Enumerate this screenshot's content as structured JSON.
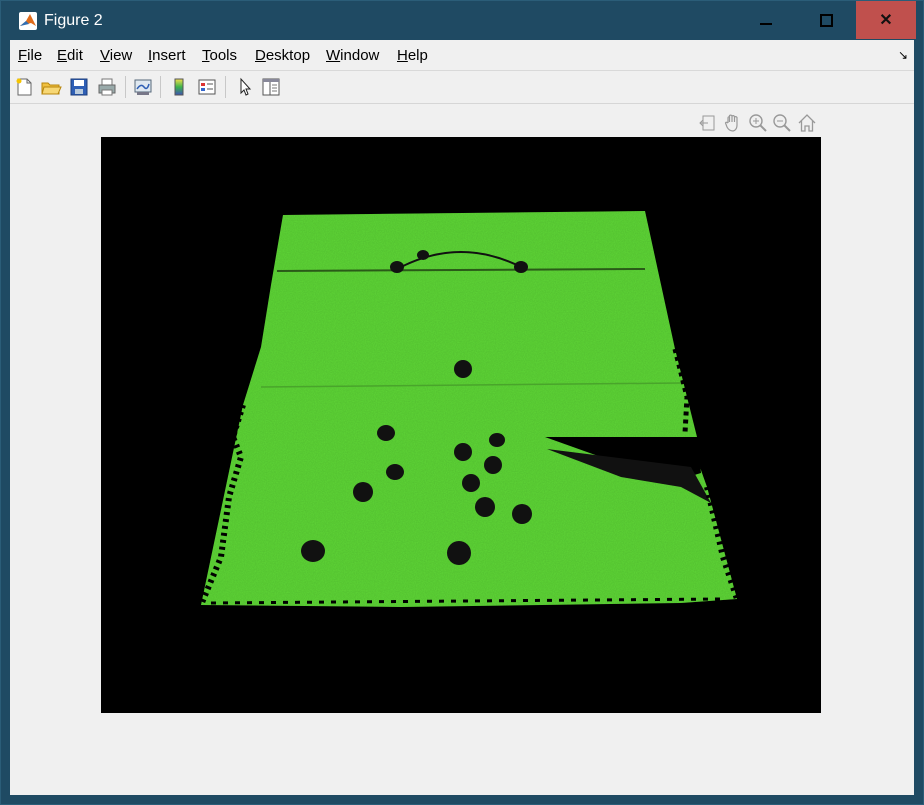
{
  "window": {
    "title": "Figure 2"
  },
  "menu": {
    "items": [
      {
        "label": "File"
      },
      {
        "label": "Edit"
      },
      {
        "label": "View"
      },
      {
        "label": "Insert"
      },
      {
        "label": "Tools"
      },
      {
        "label": "Desktop"
      },
      {
        "label": "Window"
      },
      {
        "label": "Help"
      }
    ]
  },
  "toolbar_icons": [
    "new-figure-icon",
    "open-file-icon",
    "save-icon",
    "print-icon",
    "link-plot-icon",
    "insert-colorbar-icon",
    "insert-legend-icon",
    "edit-plot-icon",
    "property-inspector-icon"
  ],
  "axes_toolbar_icons": [
    "export-icon",
    "pan-icon",
    "zoom-in-icon",
    "zoom-out-icon",
    "home-icon"
  ],
  "colors": {
    "titlebar": "#1f4a63",
    "close": "#c0504d",
    "field_green": "#5ed636",
    "background": "#000000"
  }
}
